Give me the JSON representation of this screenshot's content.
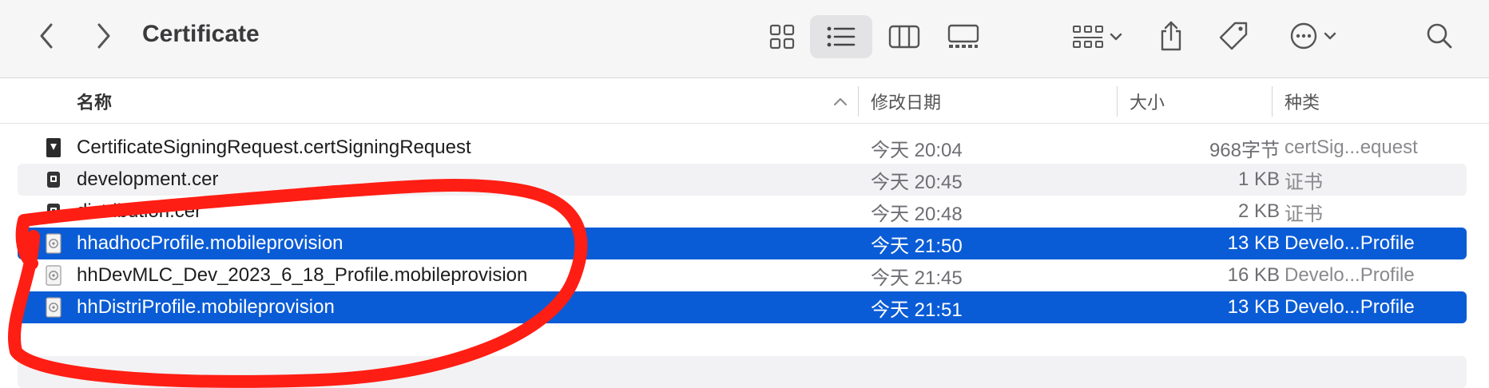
{
  "toolbar": {
    "title": "Certificate",
    "icons": {
      "back": "chevron-left-icon",
      "forward": "chevron-right-icon",
      "grid_view": "icon-grid-icon",
      "list_view": "list-view-icon",
      "column_view": "column-view-icon",
      "gallery_view": "gallery-view-icon",
      "group": "group-by-icon",
      "share": "share-icon",
      "tag": "tag-icon",
      "more": "ellipsis-circle-icon",
      "search": "search-icon"
    }
  },
  "columns": {
    "name": "名称",
    "date": "修改日期",
    "size": "大小",
    "kind": "种类"
  },
  "files": [
    {
      "name": "CertificateSigningRequest.certSigningRequest",
      "date": "今天 20:04",
      "size": "968字节",
      "kind": "certSig...equest",
      "icon": "cert-request-icon",
      "selected": false
    },
    {
      "name": "development.cer",
      "date": "今天 20:45",
      "size": "1 KB",
      "kind": "证书",
      "icon": "certificate-icon",
      "selected": false
    },
    {
      "name": "distribution.cer",
      "date": "今天 20:48",
      "size": "2 KB",
      "kind": "证书",
      "icon": "certificate-icon",
      "selected": false
    },
    {
      "name": "hhadhocProfile.mobileprovision",
      "date": "今天 21:50",
      "size": "13 KB",
      "kind": "Develo...Profile",
      "icon": "provisioning-profile-icon",
      "selected": true
    },
    {
      "name": "hhDevMLC_Dev_2023_6_18_Profile.mobileprovision",
      "date": "今天 21:45",
      "size": "16 KB",
      "kind": "Develo...Profile",
      "icon": "provisioning-profile-icon",
      "selected": false
    },
    {
      "name": "hhDistriProfile.mobileprovision",
      "date": "今天 21:51",
      "size": "13 KB",
      "kind": "Develo...Profile",
      "icon": "provisioning-profile-icon",
      "selected": true
    }
  ],
  "colors": {
    "selection": "#0a5cd6",
    "annotation": "#ff1e14"
  }
}
